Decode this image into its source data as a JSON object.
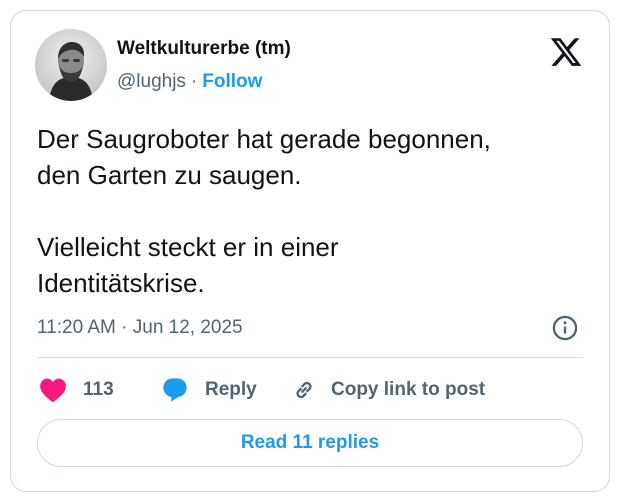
{
  "author": {
    "name": "Weltkulturerbe (tm)",
    "handle": "@lughjs",
    "separator": "·",
    "follow_label": "Follow",
    "avatar_icon": "user-avatar-photo"
  },
  "brand": {
    "logo_icon": "x-logo",
    "color": "#0f1419"
  },
  "tweet": {
    "text": "Der Saugroboter hat gerade begonnen,\nden Garten zu saugen.\n\nVielleicht steckt er in einer\nIdentitätskrise.",
    "timestamp": "11:20 AM · Jun 12, 2025",
    "info_icon": "info-icon"
  },
  "actions": {
    "like_count": "113",
    "like_icon": "heart-icon",
    "like_color": "#f91880",
    "reply_label": "Reply",
    "reply_icon": "speech-bubble-icon",
    "reply_color": "#1d9bf0",
    "copy_label": "Copy link to post",
    "copy_icon": "link-icon"
  },
  "footer": {
    "read_replies_label": "Read 11 replies"
  },
  "colors": {
    "text": "#0f1419",
    "secondary": "#536471",
    "accent": "#1d9bf0",
    "border": "#cfd9de"
  }
}
